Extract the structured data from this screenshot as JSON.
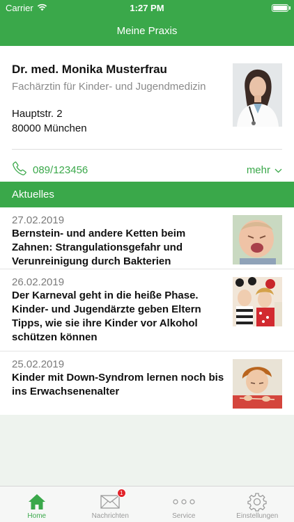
{
  "statusbar": {
    "carrier": "Carrier",
    "time": "1:27 PM"
  },
  "nav": {
    "title": "Meine Praxis"
  },
  "practice": {
    "name": "Dr. med. Monika Musterfrau",
    "specialty": "Fachärztin für Kinder- und Jugendmedizin",
    "street": "Hauptstr. 2",
    "city": "80000 München",
    "phone": "089/123456",
    "more_label": "mehr"
  },
  "news_section": {
    "title": "Aktuelles"
  },
  "news": [
    {
      "date": "27.02.2019",
      "title": "Bernstein- und andere Ketten beim Zahnen: Strangulationsgefahr und Verunreinigung durch Bakterien"
    },
    {
      "date": "26.02.2019",
      "title": "Der Karneval geht in die heiße Phase. Kinder- und Jugendärzte geben Eltern Tipps, wie sie ihre Kinder vor Alkohol schützen können"
    },
    {
      "date": "25.02.2019",
      "title": "Kinder mit Down-Syndrom lernen noch bis ins Erwachsenenalter"
    }
  ],
  "tabbar": {
    "home": "Home",
    "messages": "Nachrichten",
    "messages_badge": "1",
    "service": "Service",
    "settings": "Einstellungen"
  },
  "colors": {
    "accent": "#3aa84a",
    "badge": "#e2232a"
  }
}
